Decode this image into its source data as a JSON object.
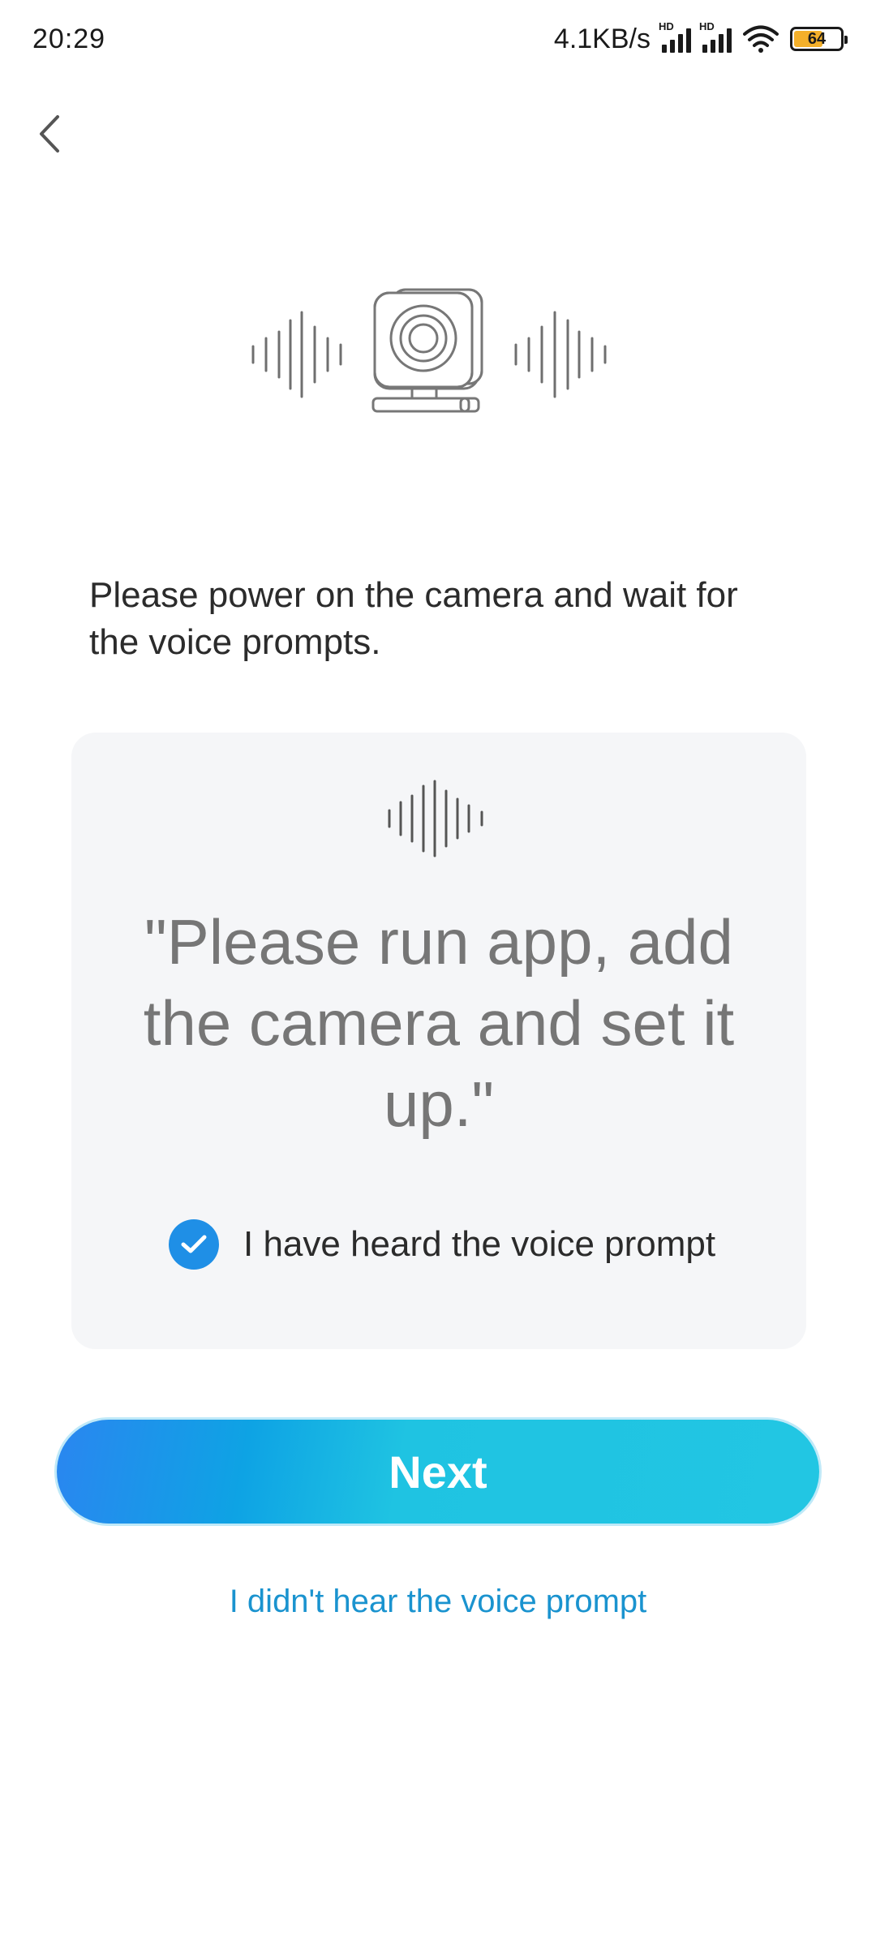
{
  "status_bar": {
    "time": "20:29",
    "net_speed": "4.1KB/s",
    "signal_1_label": "HD",
    "signal_2_label": "HD",
    "battery_level": "64",
    "battery_color": "#f4b02a"
  },
  "nav": {
    "back_icon": "chevron-left-icon"
  },
  "illustration": {
    "icon": "camera-sound-waves-icon"
  },
  "instruction": "Please power on the camera and wait for the voice prompts.",
  "card": {
    "wave_icon": "sound-wave-icon",
    "quote": "\"Please run app, add the camera and set it up.\"",
    "checkbox": {
      "label": "I have heard the voice prompt",
      "checked": true
    }
  },
  "actions": {
    "next_label": "Next",
    "alt_link_label": "I didn't hear the voice prompt"
  },
  "colors": {
    "accent": "#1f8fe6",
    "link": "#1a93cf",
    "button_gradient_start": "#2a86f0",
    "button_gradient_end": "#22c6e3"
  }
}
